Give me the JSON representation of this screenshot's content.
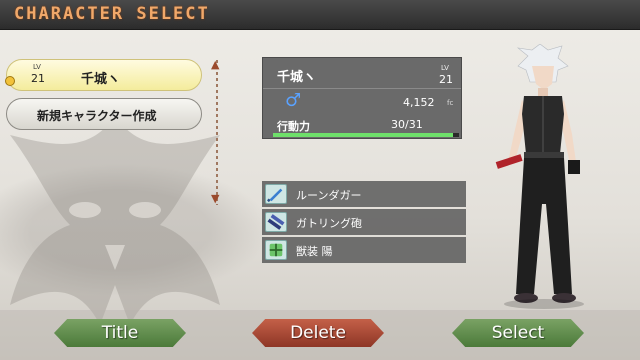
{
  "header": {
    "title": "CHARACTER SELECT"
  },
  "character_list": {
    "selected": {
      "level_label": "LV",
      "level": "21",
      "name": "千城ヽ"
    },
    "new_character_label": "新規キャラクター作成"
  },
  "info_panel": {
    "name": "千城ヽ",
    "level_label": "LV",
    "level": "21",
    "gender_symbol": "♂",
    "money": "4,152",
    "money_unit": "fc",
    "stamina_label": "行動力",
    "stamina_value": "30/31",
    "stamina_fraction": 0.968
  },
  "equipment": [
    {
      "icon": "dagger-icon",
      "label": "ルーンダガー"
    },
    {
      "icon": "gatling-gun-icon",
      "label": "ガトリング砲"
    },
    {
      "icon": "armor-icon",
      "label": "獣装 陽"
    }
  ],
  "buttons": {
    "title": "Title",
    "delete": "Delete",
    "select": "Select"
  },
  "colors": {
    "title_text": "#f0a86a",
    "confirm_button": "#5f8a4c",
    "delete_button": "#a8442f",
    "stamina_bar": "#6ee06a"
  }
}
